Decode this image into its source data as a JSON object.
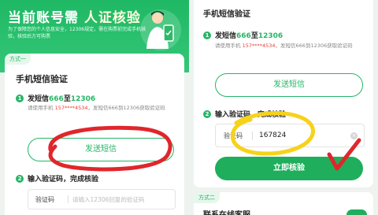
{
  "left_screen": {
    "hero": {
      "title_prefix": "当前账号需",
      "title_highlight": "人证核验",
      "description": "为了保障您的个人信息安全，12306规定，需在购票前完成手机核验，核验后方可购票"
    },
    "method_tag": "方式一",
    "card_title": "手机短信验证",
    "step1": {
      "num": "1",
      "label_prefix": "发短信",
      "number_a": "666",
      "label_mid": "至",
      "number_b": "12306",
      "desc_prefix": "请使用手机 ",
      "phone": "157****4534",
      "desc_suffix": "，发短信666到12306获取验证码"
    },
    "send_button_label": "发送短信",
    "step2": {
      "num": "2",
      "label": "输入验证码，完成核验"
    },
    "code_input": {
      "label": "验证码",
      "placeholder": "请输入12306回复的验证码"
    }
  },
  "right_screen": {
    "card_title": "手机短信验证",
    "step1": {
      "num": "1",
      "label_prefix": "发短信",
      "number_a": "666",
      "label_mid": "至",
      "number_b": "12306",
      "desc_prefix": "请使用手机 ",
      "phone": "157****4534",
      "desc_suffix": "，发短信666到12306获取验证码"
    },
    "send_button_label": "发送短信",
    "step2": {
      "num": "2",
      "label": "输入验证码，完成核验"
    },
    "code_input": {
      "label": "验证码",
      "value": "167824"
    },
    "verify_button_label": "立即核验",
    "method2_tag": "方式二",
    "bottom_title": "联系在线客服"
  },
  "colors": {
    "brand_green": "#27b566",
    "accent_red": "#e8403a",
    "annotation_red": "#e0262c",
    "annotation_yellow": "#f7d21b"
  },
  "icons": [
    "clear-icon",
    "checkmark-annotation"
  ]
}
